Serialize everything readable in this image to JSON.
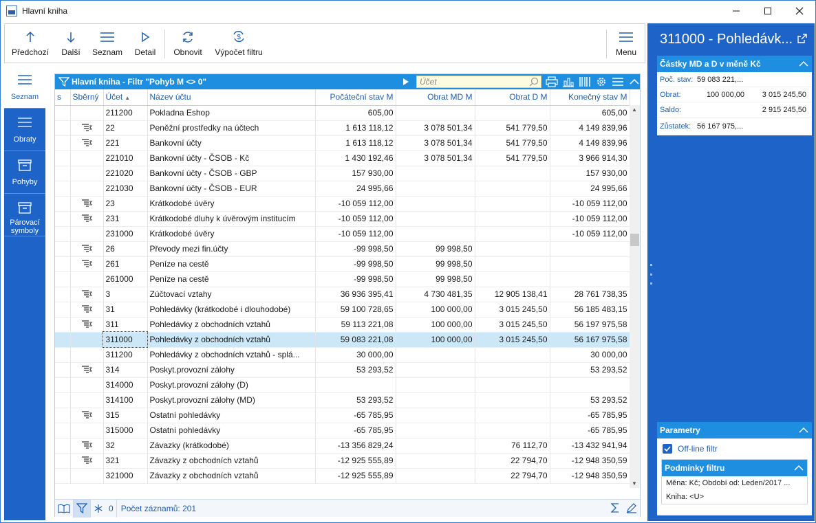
{
  "window": {
    "title": "Hlavní kniha",
    "controls": {
      "minimize": "—",
      "maximize": "☐",
      "close": "✕"
    }
  },
  "toolbar": {
    "prev_label": "Předchozí",
    "next_label": "Další",
    "list_label": "Seznam",
    "detail_label": "Detail",
    "refresh_label": "Obnovit",
    "filter_calc_label": "Výpočet filtru",
    "menu_label": "Menu"
  },
  "nav": {
    "items": [
      {
        "label": "Seznam",
        "icon": "list-icon",
        "active": true
      },
      {
        "label": "Obraty",
        "icon": "lines-icon",
        "active": false
      },
      {
        "label": "Pohyby",
        "icon": "box-icon",
        "active": false
      },
      {
        "label": "Párovací symboly",
        "icon": "box-icon",
        "active": false
      }
    ]
  },
  "grid": {
    "title": "Hlavní kniha - Filtr \"Pohyb M <> 0\"",
    "search_placeholder": "Účet",
    "columns": [
      "s",
      "Sběrný",
      "Účet",
      "Název účtu",
      "Počáteční stav M",
      "Obrat MD M",
      "Obrat D M",
      "Konečný stav M"
    ],
    "rows": [
      {
        "group": false,
        "account": "211200",
        "name": "Pokladna Eshop",
        "start": "605,00",
        "md": "",
        "d": "",
        "end": "605,00"
      },
      {
        "group": true,
        "account": "22",
        "name": "Peněžní prostředky na účtech",
        "start": "1 613 118,12",
        "md": "3 078 501,34",
        "d": "541 779,50",
        "end": "4 149 839,96"
      },
      {
        "group": true,
        "account": "221",
        "name": "Bankovní účty",
        "start": "1 613 118,12",
        "md": "3 078 501,34",
        "d": "541 779,50",
        "end": "4 149 839,96"
      },
      {
        "group": false,
        "account": "221010",
        "name": "Bankovní účty - ČSOB - Kč",
        "start": "1 430 192,46",
        "md": "3 078 501,34",
        "d": "541 779,50",
        "end": "3 966 914,30"
      },
      {
        "group": false,
        "account": "221020",
        "name": "Bankovní účty - ČSOB - GBP",
        "start": "157 930,00",
        "md": "",
        "d": "",
        "end": "157 930,00"
      },
      {
        "group": false,
        "account": "221030",
        "name": "Bankovní účty - ČSOB - EUR",
        "start": "24 995,66",
        "md": "",
        "d": "",
        "end": "24 995,66"
      },
      {
        "group": true,
        "account": "23",
        "name": "Krátkodobé úvěry",
        "start": "-10 059 112,00",
        "md": "",
        "d": "",
        "end": "-10 059 112,00"
      },
      {
        "group": true,
        "account": "231",
        "name": "Krátkodobé dluhy k úvěrovým institucím",
        "start": "-10 059 112,00",
        "md": "",
        "d": "",
        "end": "-10 059 112,00"
      },
      {
        "group": false,
        "account": "231000",
        "name": "Krátkodobé úvěry",
        "start": "-10 059 112,00",
        "md": "",
        "d": "",
        "end": "-10 059 112,00"
      },
      {
        "group": true,
        "account": "26",
        "name": "Převody mezi fin.účty",
        "start": "-99 998,50",
        "md": "99 998,50",
        "d": "",
        "end": ""
      },
      {
        "group": true,
        "account": "261",
        "name": "Peníze na cestě",
        "start": "-99 998,50",
        "md": "99 998,50",
        "d": "",
        "end": ""
      },
      {
        "group": false,
        "account": "261000",
        "name": "Peníze na cestě",
        "start": "-99 998,50",
        "md": "99 998,50",
        "d": "",
        "end": ""
      },
      {
        "group": true,
        "account": "3",
        "name": "Zúčtovací vztahy",
        "start": "36 936 395,41",
        "md": "4 730 481,35",
        "d": "12 905 138,41",
        "end": "28 761 738,35"
      },
      {
        "group": true,
        "account": "31",
        "name": "Pohledávky (krátkodobé i dlouhodobé)",
        "start": "59 100 728,65",
        "md": "100 000,00",
        "d": "3 015 245,50",
        "end": "56 185 483,15"
      },
      {
        "group": true,
        "account": "311",
        "name": "Pohledávky z obchodních vztahů",
        "start": "59 113 221,08",
        "md": "100 000,00",
        "d": "3 015 245,50",
        "end": "56 197 975,58"
      },
      {
        "group": false,
        "account": "311000",
        "name": "Pohledávky z obchodních vztahů",
        "start": "59 083 221,08",
        "md": "100 000,00",
        "d": "3 015 245,50",
        "end": "56 167 975,58",
        "selected": true
      },
      {
        "group": false,
        "account": "311200",
        "name": "Pohledávky z obchodních vztahů - splá...",
        "start": "30 000,00",
        "md": "",
        "d": "",
        "end": "30 000,00"
      },
      {
        "group": true,
        "account": "314",
        "name": "Poskyt.provozní zálohy",
        "start": "53 293,52",
        "md": "",
        "d": "",
        "end": "53 293,52"
      },
      {
        "group": false,
        "account": "314000",
        "name": "Poskyt.provozní zálohy (D)",
        "start": "",
        "md": "",
        "d": "",
        "end": ""
      },
      {
        "group": false,
        "account": "314100",
        "name": "Poskyt.provozní zálohy (MD)",
        "start": "53 293,52",
        "md": "",
        "d": "",
        "end": "53 293,52"
      },
      {
        "group": true,
        "account": "315",
        "name": "Ostatní pohledávky",
        "start": "-65 785,95",
        "md": "",
        "d": "",
        "end": "-65 785,95"
      },
      {
        "group": false,
        "account": "315000",
        "name": "Ostatní pohledávky",
        "start": "-65 785,95",
        "md": "",
        "d": "",
        "end": "-65 785,95"
      },
      {
        "group": true,
        "account": "32",
        "name": "Závazky (krátkodobé)",
        "start": "-13 356 829,24",
        "md": "",
        "d": "76 112,70",
        "end": "-13 432 941,94"
      },
      {
        "group": true,
        "account": "321",
        "name": "Závazky z obchodních vztahů",
        "start": "-12 925 555,89",
        "md": "",
        "d": "22 794,70",
        "end": "-12 948 350,59"
      },
      {
        "group": false,
        "account": "321000",
        "name": "Závazky z obchodních vztahů",
        "start": "-12 925 555,89",
        "md": "",
        "d": "22 794,70",
        "end": "-12 948 350,59"
      }
    ],
    "footer": {
      "filter_count": "0",
      "records_label": "Počet záznamů: 201"
    }
  },
  "right_panel": {
    "title": "311000 - Pohledávk...",
    "amounts_card": {
      "title": "Částky MD a D v měně Kč",
      "start_label": "Poč. stav:",
      "start_value": "59 083 221,...",
      "turnover_label": "Obrat:",
      "turnover_md": "100 000,00",
      "turnover_d": "3 015 245,50",
      "balance_label": "Saldo:",
      "balance_value": "2 915 245,50",
      "remain_label": "Zůstatek:",
      "remain_value": "56 167 975,..."
    },
    "params_card": {
      "title": "Parametry",
      "offline_label": "Off-line filtr",
      "offline_checked": true,
      "conditions_title": "Podmínky filtru",
      "conditions_line1": "Měna: Kč; Období od: Leden/2017 ...",
      "conditions_line2": "Kniha: <U>"
    }
  },
  "colors": {
    "accent": "#1e64c8",
    "header": "#1e8fe0",
    "selected_row": "#cce8f8"
  }
}
